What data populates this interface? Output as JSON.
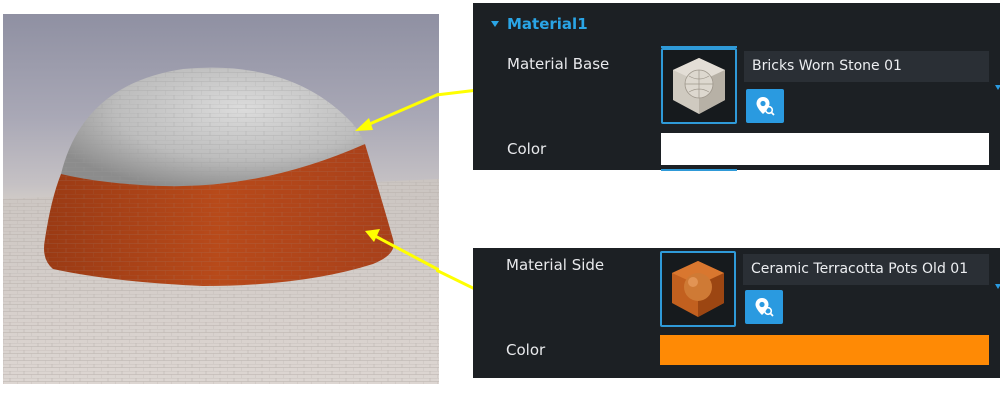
{
  "section": {
    "title": "Material1"
  },
  "material_base": {
    "label": "Material Base",
    "asset_name": "Bricks Worn Stone 01",
    "thumbnail_icon": "stone-sphere-thumbnail",
    "browse_icon": "map-pin-search-icon"
  },
  "color_base": {
    "label": "Color",
    "value": "#ffffff"
  },
  "material_side": {
    "label": "Material Side",
    "asset_name": "Ceramic Terracotta Pots Old 01",
    "thumbnail_icon": "terracotta-sphere-thumbnail",
    "browse_icon": "map-pin-search-icon"
  },
  "color_side": {
    "label": "Color",
    "value": "#ff8a05"
  },
  "colors": {
    "accent": "#2aa5e6",
    "panel_bg": "#1c2024",
    "field_bg": "#2a2f35",
    "arrow": "#ffff00"
  }
}
